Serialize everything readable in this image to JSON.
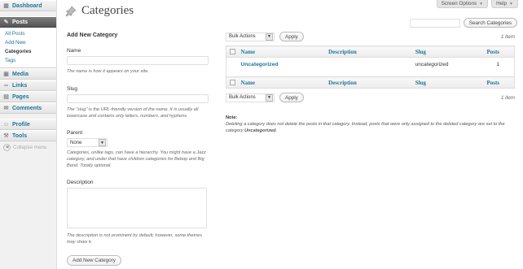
{
  "sidebar": {
    "dashboard": "Dashboard",
    "posts": "Posts",
    "posts_sub": [
      "All Posts",
      "Add New",
      "Categories",
      "Tags"
    ],
    "media": "Media",
    "links": "Links",
    "pages": "Pages",
    "comments": "Comments",
    "profile": "Profile",
    "tools": "Tools",
    "collapse": "Collapse menu"
  },
  "header": {
    "screen_options": "Screen Options",
    "help": "Help"
  },
  "page": {
    "title": "Categories",
    "search_button": "Search Categories"
  },
  "form": {
    "heading": "Add New Category",
    "name_label": "Name",
    "name_help": "The name is how it appears on your site.",
    "slug_label": "Slug",
    "slug_help": "The “slug” is the URL-friendly version of the name. It is usually all lowercase and contains only letters, numbers, and hyphens.",
    "parent_label": "Parent",
    "parent_value": "None",
    "parent_help": "Categories, unlike tags, can have a hierarchy. You might have a Jazz category, and under that have children categories for Bebop and Big Band. Totally optional.",
    "description_label": "Description",
    "description_help": "The description is not prominent by default; however, some themes may show it.",
    "submit": "Add New Category"
  },
  "table": {
    "bulk_actions": "Bulk Actions",
    "apply": "Apply",
    "count": "1 item",
    "columns": [
      "Name",
      "Description",
      "Slug",
      "Posts"
    ],
    "rows": [
      {
        "name": "Uncategorized",
        "description": "",
        "slug": "uncategorized",
        "posts": "1"
      }
    ]
  },
  "note": {
    "label": "Note:",
    "text1": "Deleting a category does not delete the posts in that category. Instead, posts that were only assigned to the deleted category are set to the category ",
    "text2": "Uncategorized",
    "text3": "."
  },
  "colors": {
    "link": "#21759b",
    "current_menu": "#6d6d6d"
  },
  "icons": {
    "title": "pushpin-icon",
    "posts": "pushpin-icon",
    "media": "media-icon",
    "links": "link-icon",
    "pages": "pages-icon",
    "comments": "comments-icon",
    "profile": "profile-icon",
    "tools": "tools-icon"
  }
}
